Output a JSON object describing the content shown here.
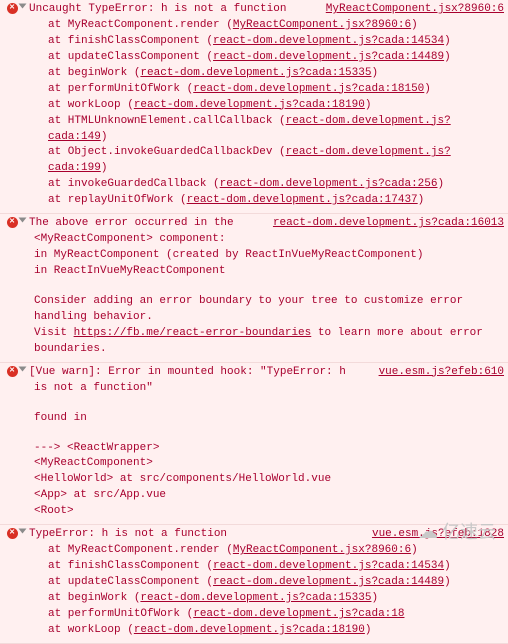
{
  "errors": [
    {
      "headline_prefix": "Uncaught TypeError: h is not a function",
      "headline_src": "MyReactComponent.jsx?8960:6",
      "stack": [
        {
          "text": "at MyReactComponent.render (",
          "link": "MyReactComponent.jsx?8960:6",
          "suffix": ")"
        },
        {
          "text": "at finishClassComponent (",
          "link": "react-dom.development.js?cada:14534",
          "suffix": ")"
        },
        {
          "text": "at updateClassComponent (",
          "link": "react-dom.development.js?cada:14489",
          "suffix": ")"
        },
        {
          "text": "at beginWork (",
          "link": "react-dom.development.js?cada:15335",
          "suffix": ")"
        },
        {
          "text": "at performUnitOfWork (",
          "link": "react-dom.development.js?cada:18150",
          "suffix": ")"
        },
        {
          "text": "at workLoop (",
          "link": "react-dom.development.js?cada:18190",
          "suffix": ")"
        },
        {
          "text": "at HTMLUnknownElement.callCallback (",
          "link": "react-dom.development.js?cada:149",
          "suffix": ")",
          "link_break": true
        },
        {
          "text": "at Object.invokeGuardedCallbackDev (",
          "link": "react-dom.development.js?cada:199",
          "suffix": ")",
          "link_break": true
        },
        {
          "text": "at invokeGuardedCallback (",
          "link": "react-dom.development.js?cada:256",
          "suffix": ")"
        },
        {
          "text": "at replayUnitOfWork (",
          "link": "react-dom.development.js?cada:17437",
          "suffix": ")"
        }
      ]
    },
    {
      "headline_prefix": "The above error occurred in the",
      "headline_src": "react-dom.development.js?cada:16013",
      "body_lines": [
        "<MyReactComponent> component:",
        "    in MyReactComponent (created by ReactInVueMyReactComponent)",
        "    in ReactInVueMyReactComponent",
        "",
        "Consider adding an error boundary to your tree to customize error handling behavior."
      ],
      "visit_prefix": "Visit ",
      "visit_link": "https://fb.me/react-error-boundaries",
      "visit_suffix": " to learn more about error boundaries."
    },
    {
      "headline_prefix": "[Vue warn]: Error in mounted hook: \"TypeError: h",
      "headline_src": "vue.esm.js?efeb:610",
      "cont": "is not a function\"",
      "body_lines": [
        "",
        "found in",
        "",
        "---> <ReactWrapper>",
        "       <MyReactComponent>",
        "         <HelloWorld> at src/components/HelloWorld.vue",
        "           <App> at src/App.vue",
        "             <Root>"
      ]
    },
    {
      "headline_prefix": "TypeError: h is not a function",
      "headline_src": "vue.esm.js?efeb:1828",
      "stack": [
        {
          "text": "at MyReactComponent.render (",
          "link": "MyReactComponent.jsx?8960:6",
          "suffix": ")"
        },
        {
          "text": "at finishClassComponent (",
          "link": "react-dom.development.js?cada:14534",
          "suffix": ")"
        },
        {
          "text": "at updateClassComponent (",
          "link": "react-dom.development.js?cada:14489",
          "suffix": ")"
        },
        {
          "text": "at beginWork (",
          "link": "react-dom.development.js?cada:15335",
          "suffix": ")"
        },
        {
          "text": "at performUnitOfWork (",
          "link": "react-dom.development.js?cada:18",
          "suffix": ""
        },
        {
          "text": "at workLoop (",
          "link": "react-dom.development.js?cada:18190",
          "suffix": ")"
        }
      ]
    }
  ],
  "watermark": "亿速云"
}
